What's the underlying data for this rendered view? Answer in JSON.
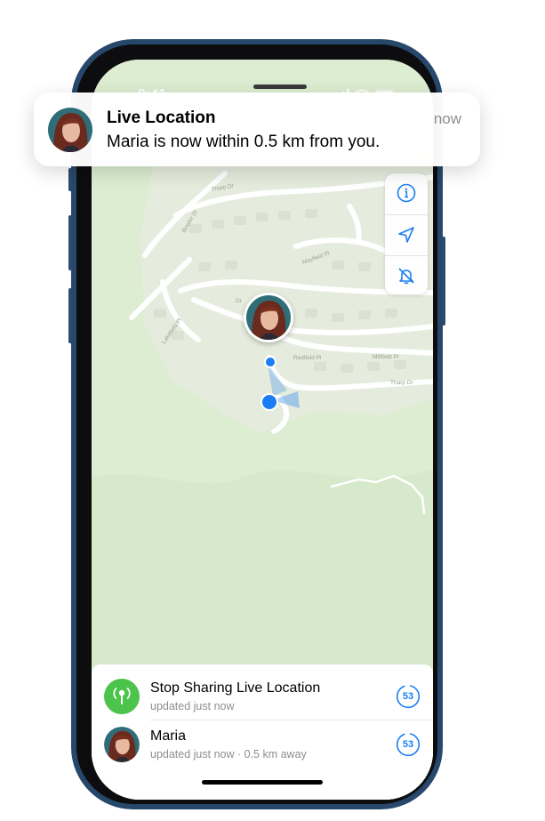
{
  "status_bar": {
    "time": "9:41"
  },
  "map": {
    "street_labels": [
      "Tharp Dr",
      "Bowler Dr",
      "Mayfield Pl",
      "Dr",
      "Lakefield Pl",
      "Redfield Pl",
      "Millfield Pl",
      "Tharp Dr"
    ],
    "controls": [
      "info-icon",
      "location-arrow-icon",
      "bell-slash-icon"
    ],
    "accent_color": "#1a7ef2"
  },
  "notification": {
    "title": "Live Location",
    "body": "Maria is now within 0.5 km from you.",
    "time": "now"
  },
  "sheet": {
    "rows": [
      {
        "title": "Stop Sharing Live Location",
        "subtitle": "updated just now",
        "timer": "53",
        "icon": "live-location-pin-icon",
        "icon_color": "#4cc34a"
      },
      {
        "title": "Maria",
        "subtitle": "updated just now · 0.5 km away",
        "timer": "53",
        "icon": "avatar"
      }
    ]
  }
}
